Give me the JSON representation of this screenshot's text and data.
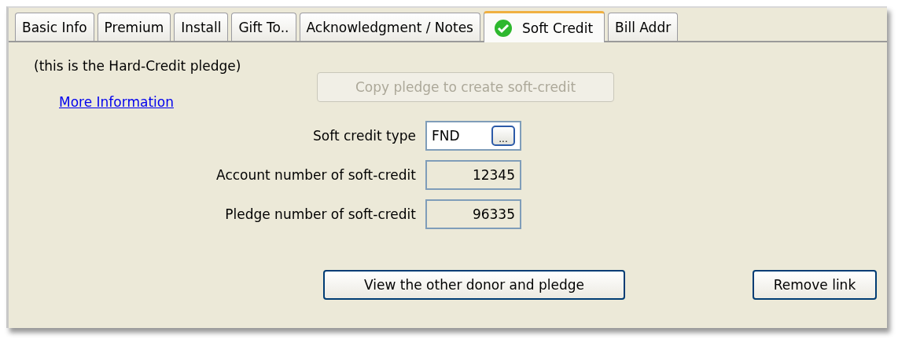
{
  "tabs": [
    {
      "label": "Basic Info",
      "selected": false,
      "checked": false
    },
    {
      "label": "Premium",
      "selected": false,
      "checked": false
    },
    {
      "label": "Install",
      "selected": false,
      "checked": false
    },
    {
      "label": "Gift To..",
      "selected": false,
      "checked": false
    },
    {
      "label": "Acknowledgment / Notes",
      "selected": false,
      "checked": false
    },
    {
      "label": "Soft Credit",
      "selected": true,
      "checked": true
    },
    {
      "label": "Bill Addr",
      "selected": false,
      "checked": false
    }
  ],
  "note": "(this is the Hard-Credit pledge)",
  "link": "More Information",
  "copy_button": {
    "label": "Copy pledge to create soft-credit",
    "disabled": true
  },
  "fields": [
    {
      "kind": "lookup",
      "label": "Soft credit type",
      "value": "FND",
      "button": "..."
    },
    {
      "kind": "number",
      "label": "Account number of soft-credit",
      "value": "12345"
    },
    {
      "kind": "number",
      "label": "Pledge number of soft-credit",
      "value": "96335"
    }
  ],
  "buttons": [
    {
      "label": "View the other donor and pledge"
    },
    {
      "label": "Remove link"
    }
  ]
}
